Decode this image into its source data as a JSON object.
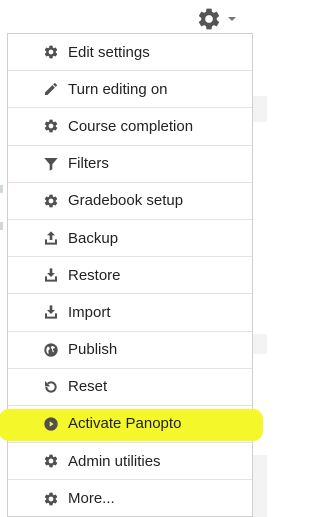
{
  "menu": {
    "items": [
      {
        "id": "edit-settings",
        "label": "Edit settings",
        "icon": "gear-icon"
      },
      {
        "id": "turn-editing-on",
        "label": "Turn editing on",
        "icon": "pencil-icon"
      },
      {
        "id": "course-completion",
        "label": "Course completion",
        "icon": "gear-icon"
      },
      {
        "id": "filters",
        "label": "Filters",
        "icon": "filter-icon"
      },
      {
        "id": "gradebook-setup",
        "label": "Gradebook setup",
        "icon": "gear-icon"
      },
      {
        "id": "backup",
        "label": "Backup",
        "icon": "upload-icon"
      },
      {
        "id": "restore",
        "label": "Restore",
        "icon": "download-icon"
      },
      {
        "id": "import",
        "label": "Import",
        "icon": "import-icon"
      },
      {
        "id": "publish",
        "label": "Publish",
        "icon": "globe-icon"
      },
      {
        "id": "reset",
        "label": "Reset",
        "icon": "reset-icon"
      },
      {
        "id": "activate-panopto",
        "label": "Activate Panopto",
        "icon": "panopto-icon"
      },
      {
        "id": "admin-utilities",
        "label": "Admin utilities",
        "icon": "gear-icon"
      },
      {
        "id": "more",
        "label": "More...",
        "icon": "gear-icon"
      }
    ]
  },
  "colors": {
    "icon": "#505050",
    "highlight": "#f4f82a",
    "border": "#cfcfcf",
    "text": "#222222"
  }
}
